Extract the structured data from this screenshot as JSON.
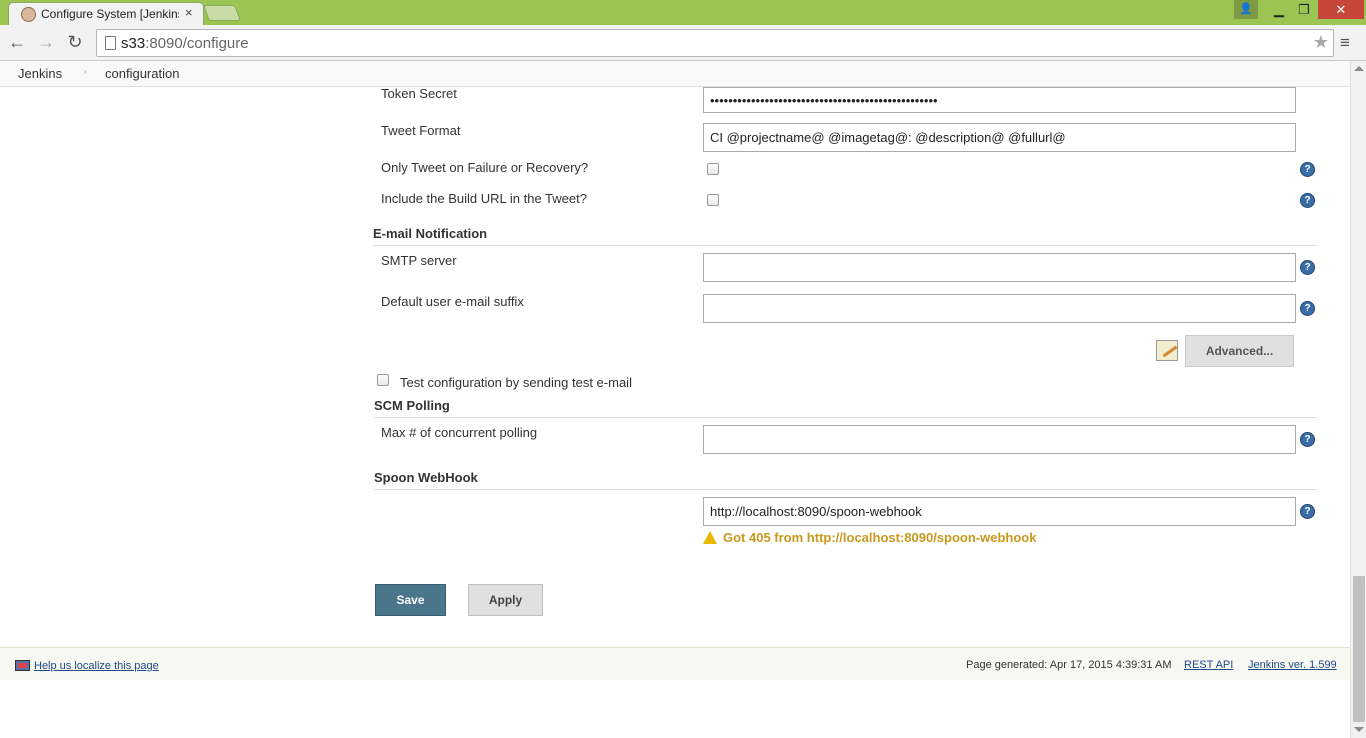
{
  "browser": {
    "tab_title": "Configure System [Jenkins]",
    "tab_close": "×",
    "url_host": "s33",
    "url_rest": ":8090/configure",
    "win_minimize": "▁",
    "win_restore": "❐",
    "win_close": "✕",
    "win_user": "👤"
  },
  "breadcrumb": {
    "items": [
      "Jenkins",
      "configuration"
    ],
    "separator": "›"
  },
  "twitter": {
    "token_secret_label": "Token Secret",
    "token_secret_value": "••••••••••••••••••••••••••••••••••••••••••••••••••",
    "tweet_format_label": "Tweet Format",
    "tweet_format_value": "CI @projectname@ @imagetag@: @description@ @fullurl@",
    "only_failure_label": "Only Tweet on Failure or Recovery?",
    "include_url_label": "Include the Build URL in the Tweet?"
  },
  "email": {
    "section_title": "E-mail Notification",
    "smtp_label": "SMTP server",
    "smtp_value": "",
    "suffix_label": "Default user e-mail suffix",
    "suffix_value": "",
    "advanced_label": "Advanced...",
    "test_label": "Test configuration by sending test e-mail"
  },
  "scm": {
    "section_title": "SCM Polling",
    "max_polling_label": "Max # of concurrent polling",
    "max_polling_value": ""
  },
  "spoon": {
    "section_title": "Spoon WebHook",
    "url_value": "http://localhost:8090/spoon-webhook",
    "warning": "Got 405 from http://localhost:8090/spoon-webhook"
  },
  "actions": {
    "save": "Save",
    "apply": "Apply"
  },
  "footer": {
    "localize": "Help us localize this page",
    "generated": "Page generated: Apr 17, 2015 4:39:31 AM",
    "rest_api": "REST API",
    "version": "Jenkins ver. 1.599"
  },
  "help_glyph": "?",
  "colors": {
    "chrome_accent": "#9bc452",
    "save_button": "#4b758b",
    "warning": "#c79a1e",
    "help_icon": "#3a6ea8"
  }
}
